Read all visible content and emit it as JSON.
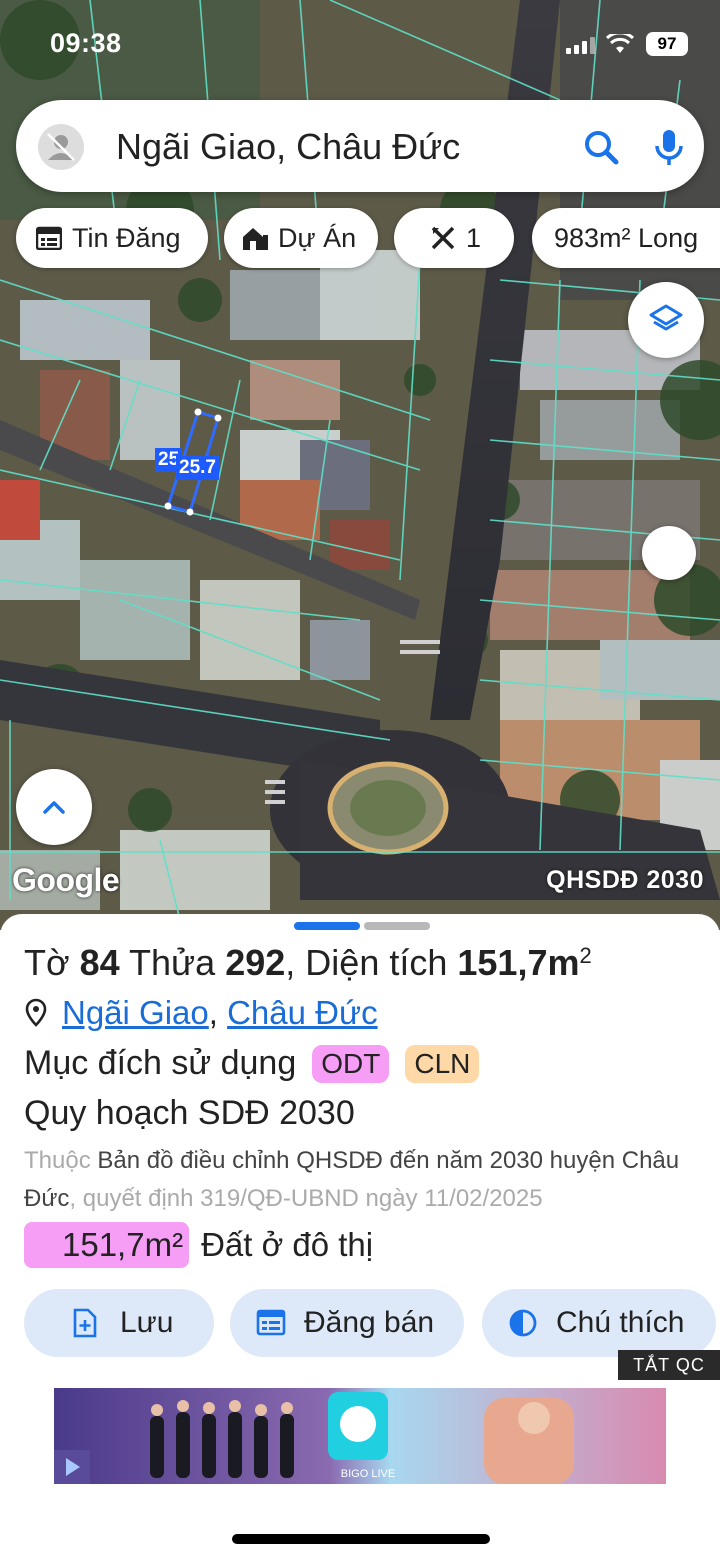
{
  "status_bar": {
    "time": "09:38",
    "battery": "97"
  },
  "search": {
    "query": "Ngãi Giao, Châu Đức"
  },
  "chips": [
    {
      "label": "Tin Đăng",
      "icon": "calendar-icon"
    },
    {
      "label": "Dự Án",
      "icon": "home-building-icon"
    },
    {
      "label": "1",
      "icon": "ruler-icon"
    },
    {
      "label": "983m² Long",
      "icon": ""
    }
  ],
  "map": {
    "plot_labels": [
      "25",
      "25.7"
    ],
    "google_logo": "Google",
    "layer_name": "QHSDĐ 2030"
  },
  "parcel": {
    "sheet_label": "Tờ",
    "sheet_no": "84",
    "parcel_label": "Thửa",
    "parcel_no": "292",
    "area_label": "Diện tích",
    "area_value": "151,7m",
    "area_unit_sup": "2",
    "location_ward": "Ngãi Giao",
    "location_sep": ",",
    "location_district": "Châu Đức",
    "purpose_label": "Mục đích sử dụng",
    "purpose_tags": [
      {
        "code": "ODT",
        "color": "#f69df6"
      },
      {
        "code": "CLN",
        "color": "#ffd8a8"
      }
    ],
    "plan_title": "Quy hoạch SDĐ 2030",
    "note_prefix": "Thuộc",
    "note_map_a": "Bản đồ điều chỉnh QHSDĐ đến năm 2030 huyện",
    "note_map_b": "Châu Đức",
    "note_decision": ", quyết định 319/QĐ-UBND ngày 11/02/2025",
    "area_badge": "151,7m²",
    "land_type": "Đất ở đô thị"
  },
  "actions": [
    {
      "label": "Lưu",
      "icon": "add-file-icon"
    },
    {
      "label": "Đăng bán",
      "icon": "calendar-icon"
    },
    {
      "label": "Chú thích",
      "icon": "contrast-icon"
    }
  ],
  "ad": {
    "close_label": "TẮT QC",
    "brand": "BIGO LIVE"
  },
  "colors": {
    "accent": "#1a73e8",
    "pager_active": "#1a73e8",
    "pager_inactive": "#b8b8b8",
    "action_bg": "#dde9f8"
  }
}
